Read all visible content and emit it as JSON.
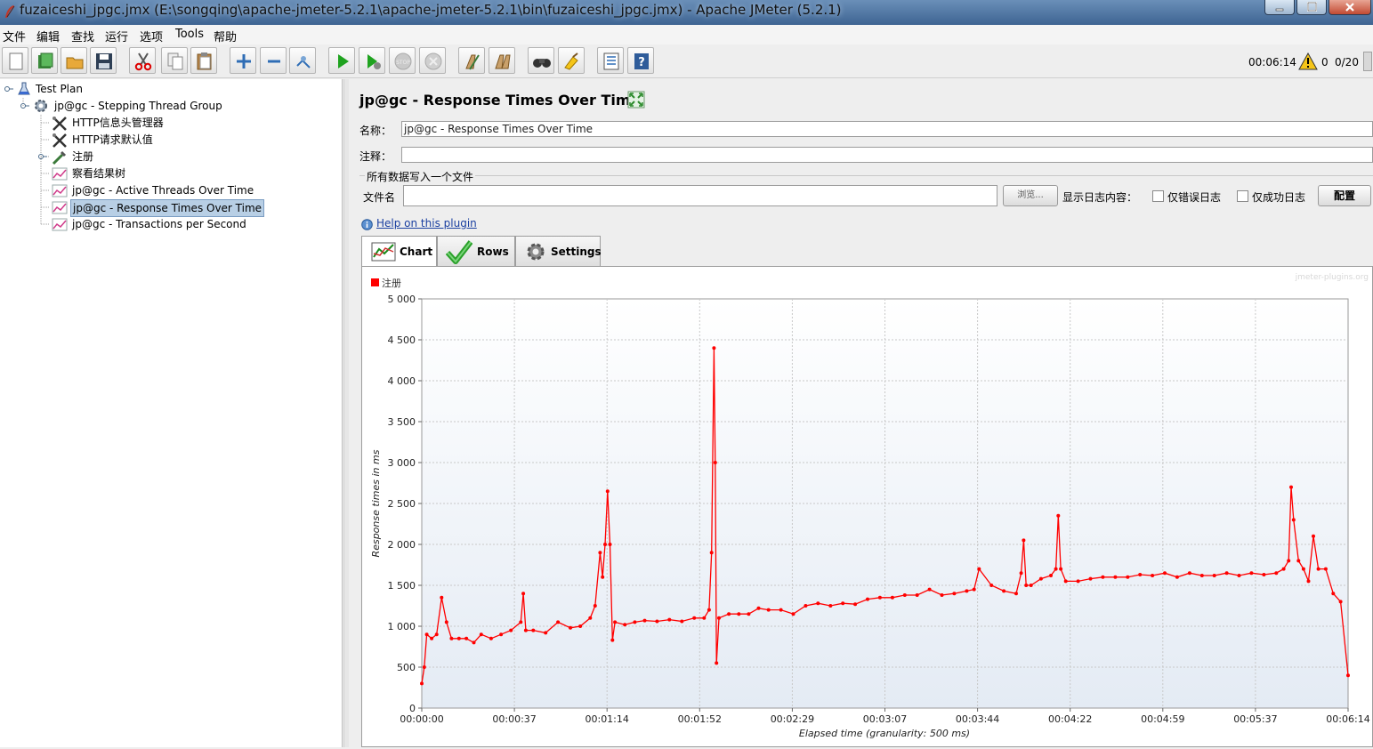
{
  "window": {
    "title": "fuzaiceshi_jpgc.jmx (E:\\songqing\\apache-jmeter-5.2.1\\apache-jmeter-5.2.1\\bin\\fuzaiceshi_jpgc.jmx) - Apache JMeter (5.2.1)"
  },
  "menu": [
    "文件",
    "编辑",
    "查找",
    "运行",
    "选项",
    "Tools",
    "帮助"
  ],
  "toolbar": {
    "buttons": [
      "new-icon",
      "templates-icon",
      "open-icon",
      "save-icon",
      "cut-icon",
      "copy-icon",
      "paste-icon",
      "expand-icon",
      "collapse-icon",
      "toggle-icon",
      "start-icon",
      "start-no-pause-icon",
      "stop-icon",
      "shutdown-icon",
      "clear-icon",
      "clear-all-icon",
      "search-icon",
      "reset-search-icon",
      "function-helper-icon",
      "help-icon"
    ],
    "elapsed": "00:06:14",
    "warnings": "0",
    "threads": "0/20"
  },
  "tree": {
    "items": [
      {
        "label": "Test Plan",
        "icon": "test-plan-icon"
      },
      {
        "label": "jp@gc - Stepping Thread Group",
        "icon": "gear-icon"
      },
      {
        "label": "HTTP信息头管理器",
        "icon": "wrench-icon"
      },
      {
        "label": "HTTP请求默认值",
        "icon": "wrench-icon"
      },
      {
        "label": "注册",
        "icon": "pipette-icon"
      },
      {
        "label": "察看结果树",
        "icon": "graph-icon"
      },
      {
        "label": "jp@gc - Active Threads Over Time",
        "icon": "graph-icon"
      },
      {
        "label": "jp@gc - Response Times Over Time",
        "icon": "graph-icon"
      },
      {
        "label": "jp@gc - Transactions per Second",
        "icon": "graph-icon"
      }
    ]
  },
  "panel": {
    "title": "jp@gc - Response Times Over Time",
    "name_label": "名称：",
    "name_value": "jp@gc - Response Times Over Time",
    "comment_label": "注释：",
    "comment_value": "",
    "file_section": "所有数据写入一个文件",
    "file_label": "文件名",
    "file_value": "",
    "browse_label": "浏览...",
    "log_label": "显示日志内容：",
    "errors_only": "仅错误日志",
    "success_only": "仅成功日志",
    "configure": "配置",
    "help_link": "Help on this plugin",
    "tabs": [
      "Chart",
      "Rows",
      "Settings"
    ],
    "watermark": "jmeter-plugins.org"
  },
  "chart_data": {
    "type": "line",
    "title": "",
    "xlabel": "Elapsed time (granularity: 500 ms)",
    "ylabel": "Response times in ms",
    "ylim": [
      0,
      5000
    ],
    "xlim_seconds": [
      0,
      374
    ],
    "yticks": [
      "0",
      "500",
      "1 000",
      "1 500",
      "2 000",
      "2 500",
      "3 000",
      "3 500",
      "4 000",
      "4 500",
      "5 000"
    ],
    "xticks": [
      "00:00:00",
      "00:00:37",
      "00:01:14",
      "00:01:52",
      "00:02:29",
      "00:03:07",
      "00:03:44",
      "00:04:22",
      "00:04:59",
      "00:05:37",
      "00:06:14"
    ],
    "legend_position": "top-left",
    "grid": true,
    "series": [
      {
        "name": "注册",
        "color": "#ff0000",
        "points": [
          [
            0,
            300
          ],
          [
            1,
            500
          ],
          [
            2,
            900
          ],
          [
            4,
            850
          ],
          [
            6,
            900
          ],
          [
            8,
            1350
          ],
          [
            10,
            1050
          ],
          [
            12,
            850
          ],
          [
            15,
            850
          ],
          [
            18,
            850
          ],
          [
            21,
            800
          ],
          [
            24,
            900
          ],
          [
            28,
            850
          ],
          [
            32,
            900
          ],
          [
            36,
            950
          ],
          [
            40,
            1050
          ],
          [
            41,
            1400
          ],
          [
            42,
            950
          ],
          [
            45,
            950
          ],
          [
            50,
            920
          ],
          [
            55,
            1050
          ],
          [
            60,
            980
          ],
          [
            64,
            1000
          ],
          [
            68,
            1100
          ],
          [
            70,
            1250
          ],
          [
            72,
            1900
          ],
          [
            73,
            1600
          ],
          [
            74,
            2000
          ],
          [
            75,
            2650
          ],
          [
            76,
            2000
          ],
          [
            77,
            830
          ],
          [
            78,
            1050
          ],
          [
            82,
            1020
          ],
          [
            86,
            1050
          ],
          [
            90,
            1070
          ],
          [
            95,
            1060
          ],
          [
            100,
            1080
          ],
          [
            105,
            1060
          ],
          [
            110,
            1100
          ],
          [
            114,
            1100
          ],
          [
            116,
            1200
          ],
          [
            117,
            1900
          ],
          [
            118,
            4400
          ],
          [
            118.5,
            3000
          ],
          [
            119,
            550
          ],
          [
            120,
            1100
          ],
          [
            124,
            1150
          ],
          [
            128,
            1150
          ],
          [
            132,
            1150
          ],
          [
            136,
            1220
          ],
          [
            140,
            1200
          ],
          [
            145,
            1200
          ],
          [
            150,
            1150
          ],
          [
            155,
            1250
          ],
          [
            160,
            1280
          ],
          [
            165,
            1250
          ],
          [
            170,
            1280
          ],
          [
            175,
            1270
          ],
          [
            180,
            1330
          ],
          [
            185,
            1350
          ],
          [
            190,
            1350
          ],
          [
            195,
            1380
          ],
          [
            200,
            1380
          ],
          [
            205,
            1450
          ],
          [
            210,
            1380
          ],
          [
            215,
            1400
          ],
          [
            220,
            1430
          ],
          [
            223,
            1450
          ],
          [
            225,
            1700
          ],
          [
            230,
            1500
          ],
          [
            235,
            1430
          ],
          [
            240,
            1400
          ],
          [
            242,
            1650
          ],
          [
            243,
            2050
          ],
          [
            244,
            1500
          ],
          [
            246,
            1500
          ],
          [
            250,
            1580
          ],
          [
            254,
            1620
          ],
          [
            256,
            1700
          ],
          [
            257,
            2350
          ],
          [
            258,
            1700
          ],
          [
            260,
            1550
          ],
          [
            265,
            1550
          ],
          [
            270,
            1580
          ],
          [
            275,
            1600
          ],
          [
            280,
            1600
          ],
          [
            285,
            1600
          ],
          [
            290,
            1630
          ],
          [
            295,
            1620
          ],
          [
            300,
            1650
          ],
          [
            305,
            1600
          ],
          [
            310,
            1650
          ],
          [
            315,
            1620
          ],
          [
            320,
            1620
          ],
          [
            325,
            1650
          ],
          [
            330,
            1620
          ],
          [
            335,
            1650
          ],
          [
            340,
            1630
          ],
          [
            345,
            1650
          ],
          [
            348,
            1700
          ],
          [
            350,
            1800
          ],
          [
            351,
            2700
          ],
          [
            352,
            2300
          ],
          [
            354,
            1800
          ],
          [
            356,
            1700
          ],
          [
            358,
            1550
          ],
          [
            360,
            2100
          ],
          [
            362,
            1700
          ],
          [
            365,
            1700
          ],
          [
            368,
            1400
          ],
          [
            371,
            1300
          ],
          [
            374,
            400
          ]
        ]
      }
    ]
  }
}
